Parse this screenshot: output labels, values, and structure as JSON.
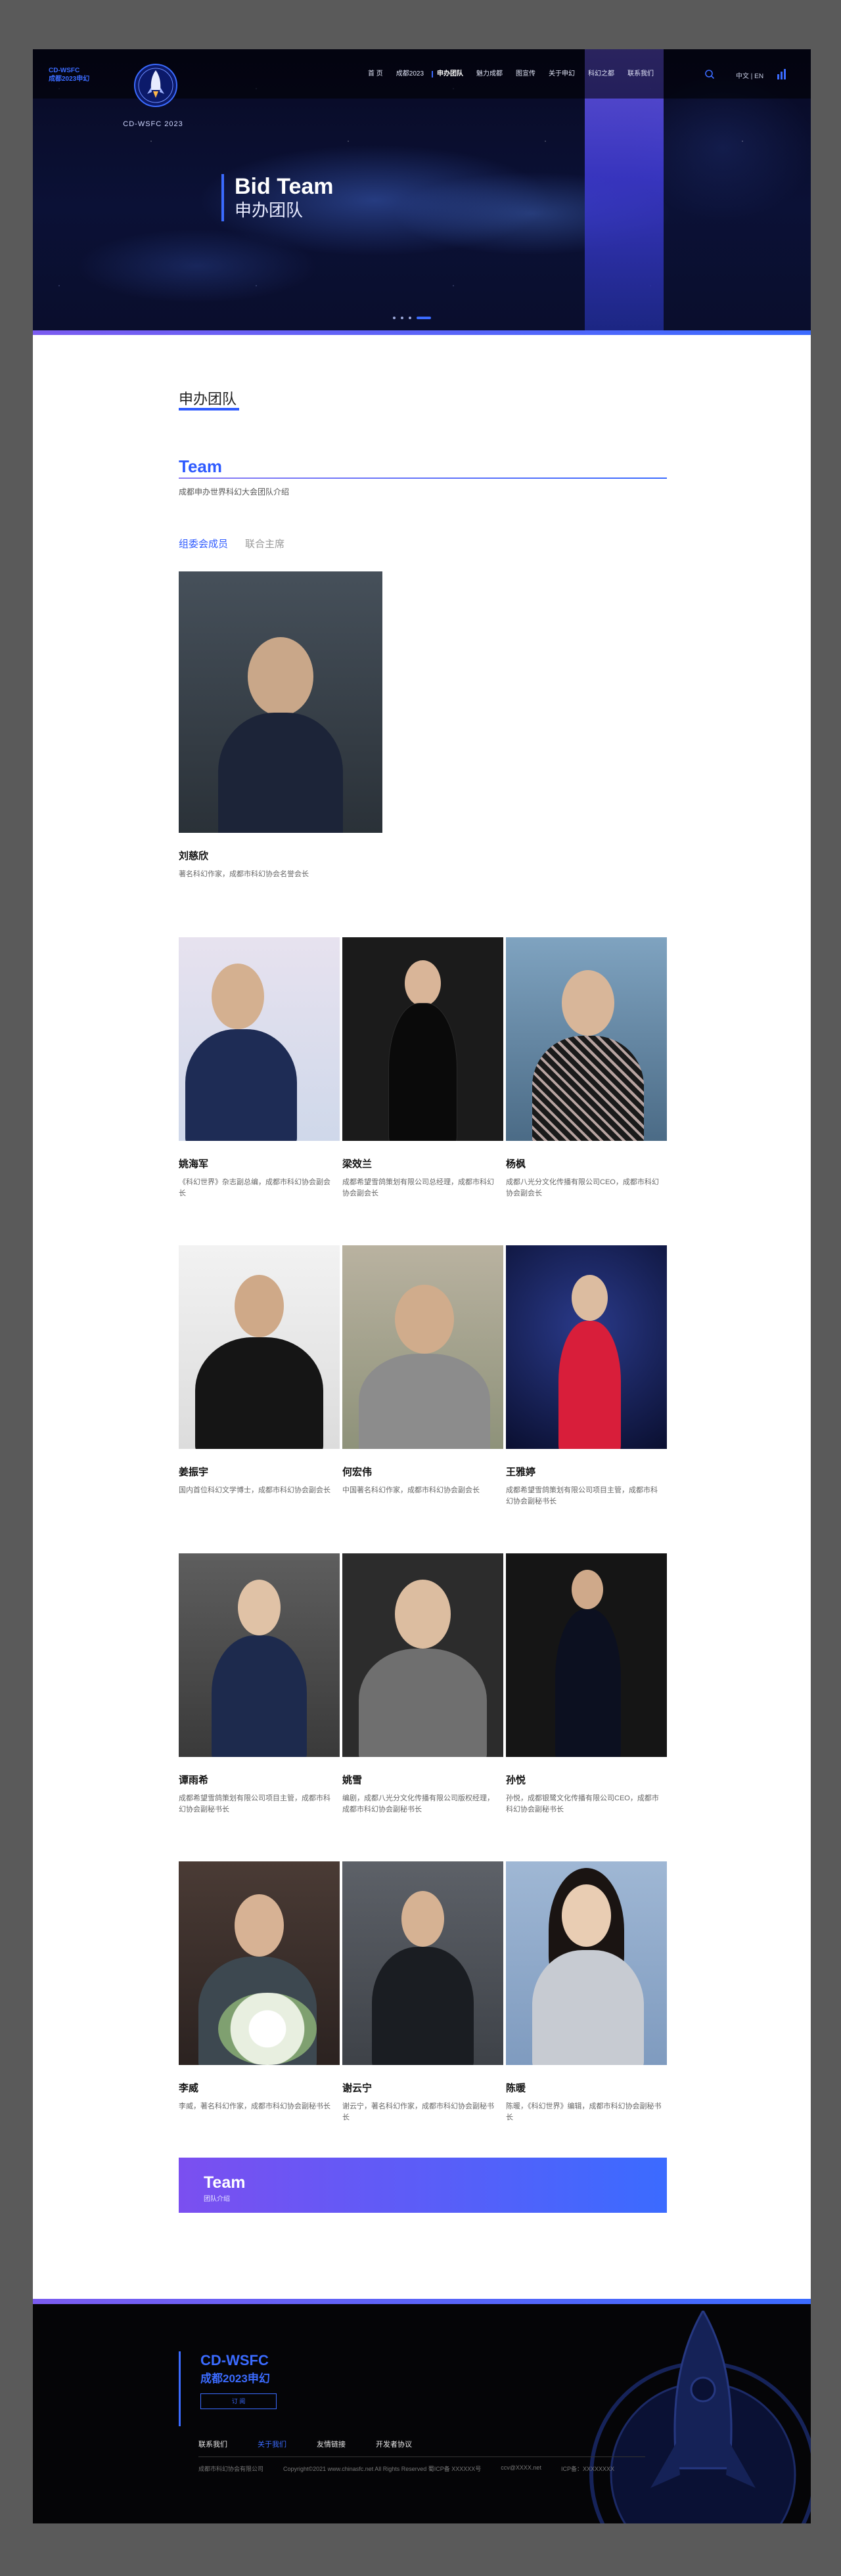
{
  "header": {
    "brand_line1": "CD-WSFC",
    "brand_line2": "成都2023申幻",
    "logo_subtitle": "CD-WSFC 2023",
    "nav": [
      "首 页",
      "成都2023",
      "申办团队",
      "魅力成都",
      "图宣传",
      "关于申幻",
      "科幻之都",
      "联系我们"
    ],
    "active_nav_index": 2,
    "lang": "中文 | EN"
  },
  "hero": {
    "title_en": "Bid Team",
    "title_cn": "申办团队",
    "slide_count": 4,
    "active_slide": 3
  },
  "section": {
    "title": "申办团队",
    "team_heading": "Team",
    "team_subtitle": "成都申办世界科幻大会团队介绍",
    "tabs": [
      "组委会成员",
      "联合主席"
    ],
    "active_tab": 0
  },
  "members": [
    {
      "name": "刘慈欣",
      "desc": "著名科幻作家，成都市科幻协会名誉会长"
    },
    {
      "name": "姚海军",
      "desc": "《科幻世界》杂志副总编，成都市科幻协会副会长"
    },
    {
      "name": "梁效兰",
      "desc": "成都希望雪鸽策划有限公司总经理，成都市科幻协会副会长"
    },
    {
      "name": "杨枫",
      "desc": "成都八光分文化传播有限公司CEO，成都市科幻协会副会长"
    },
    {
      "name": "姜振宇",
      "desc": "国内首位科幻文学博士，成都市科幻协会副会长"
    },
    {
      "name": "何宏伟",
      "desc": "中国著名科幻作家，成都市科幻协会副会长"
    },
    {
      "name": "王雅婷",
      "desc": "成都希望雪鸽策划有限公司项目主管，成都市科幻协会副秘书长"
    },
    {
      "name": "谭雨希",
      "desc": "成都希望雪鸽策划有限公司项目主管，成都市科幻协会副秘书长"
    },
    {
      "name": "姚雪",
      "desc": "编剧，成都八光分文化传播有限公司版权经理，成都市科幻协会副秘书长"
    },
    {
      "name": "孙悦",
      "desc": "孙悦，成都银鹭文化传播有限公司CEO，成都市科幻协会副秘书长"
    },
    {
      "name": "李威",
      "desc": "李威，著名科幻作家，成都市科幻协会副秘书长"
    },
    {
      "name": "谢云宁",
      "desc": "谢云宁，著名科幻作家，成都市科幻协会副秘书长"
    },
    {
      "name": "陈暖",
      "desc": "陈暖，《科幻世界》编辑，成都市科幻协会副秘书长"
    }
  ],
  "banner": {
    "title": "Team",
    "subtitle": "团队介绍"
  },
  "footer": {
    "brand_line1": "CD-WSFC",
    "brand_line2": "成都2023申幻",
    "button": "订 阅",
    "links": [
      "联系我们",
      "关于我们",
      "友情链接",
      "开发者协议"
    ],
    "active_link_index": 1,
    "copyright": [
      "成都市科幻协会有限公司",
      "Copyright©2021 www.chinasfc.net All Rights Reserved 蜀ICP备 XXXXXX号",
      "ccv@XXXX.net",
      "ICP备：XXXXXXXX"
    ]
  },
  "colors": {
    "accent": "#2f5bff",
    "purple": "#7b4ff0",
    "hero_bg": "#0b1136",
    "footer_bg": "#050507"
  }
}
